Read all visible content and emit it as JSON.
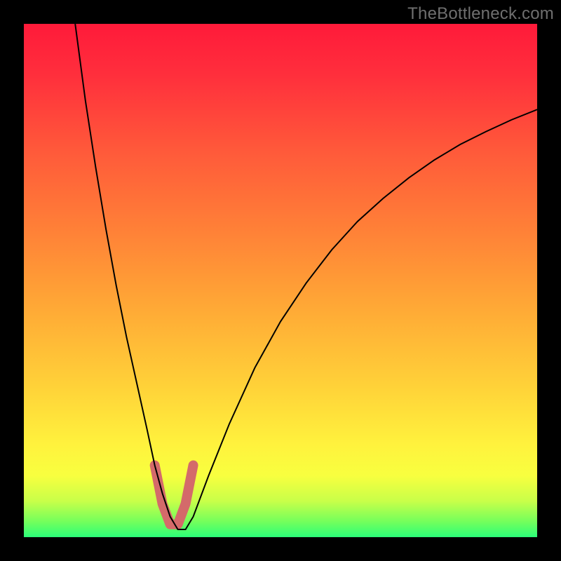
{
  "watermark": {
    "text": "TheBottleneck.com"
  },
  "chart_data": {
    "type": "line",
    "title": "",
    "xlabel": "",
    "ylabel": "",
    "xlim": [
      0,
      100
    ],
    "ylim": [
      0,
      100
    ],
    "series": [
      {
        "name": "curve",
        "color": "#000000",
        "width": 2,
        "x": [
          10,
          12,
          14,
          16,
          18,
          20,
          22,
          24,
          25.5,
          27,
          28.5,
          30,
          31.5,
          33,
          36,
          40,
          45,
          50,
          55,
          60,
          65,
          70,
          75,
          80,
          85,
          90,
          95,
          100
        ],
        "y": [
          100,
          85,
          72,
          60,
          49,
          39,
          30,
          21,
          14,
          8.5,
          4,
          1.5,
          1.5,
          4,
          12,
          22,
          33,
          42,
          49.5,
          56,
          61.5,
          66,
          70,
          73.5,
          76.5,
          79,
          81.3,
          83.3
        ]
      },
      {
        "name": "bracket",
        "color": "#d46a6a",
        "width": 14,
        "linecap": "round",
        "x": [
          25.5,
          27,
          28.5,
          30,
          31.5,
          33
        ],
        "y": [
          14,
          6.5,
          2.5,
          2.5,
          6.5,
          14
        ]
      }
    ]
  }
}
